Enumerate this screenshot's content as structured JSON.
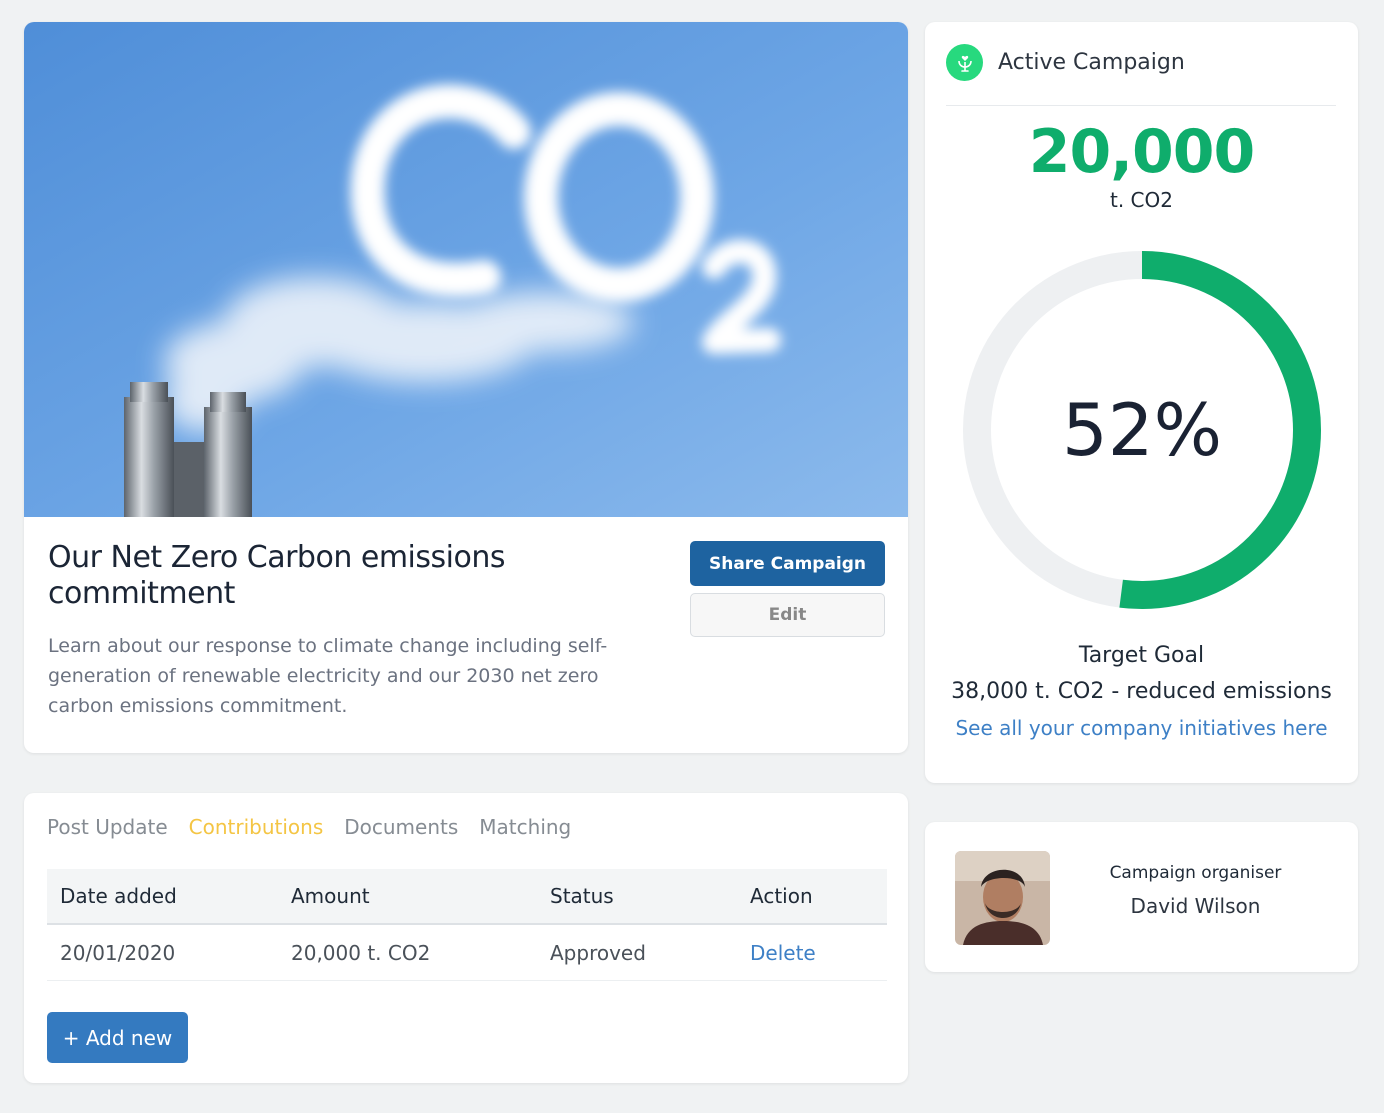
{
  "hero": {
    "title": "Our Net Zero Carbon emissions commitment",
    "description": "Learn about our response to climate change including self-generation of renewable electricity and our 2030 net zero carbon emissions commitment.",
    "share_label": "Share Campaign",
    "edit_label": "Edit",
    "image": "co2-cloud-chimney-photo"
  },
  "tabs": [
    {
      "label": "Post Update",
      "active": false
    },
    {
      "label": "Contributions",
      "active": true
    },
    {
      "label": "Documents",
      "active": false
    },
    {
      "label": "Matching",
      "active": false
    }
  ],
  "table": {
    "headers": [
      "Date added",
      "Amount",
      "Status",
      "Action"
    ],
    "rows": [
      {
        "date": "20/01/2020",
        "amount": "20,000 t. CO2",
        "status": "Approved",
        "action": "Delete"
      }
    ]
  },
  "add_label": "+ Add new",
  "campaign": {
    "label": "Active Campaign",
    "amount": "20,000",
    "unit": "t. CO2",
    "percent_label": "52%",
    "progress": 0.52,
    "goal_label": "Target Goal",
    "goal_value": "38,000 t. CO2 - reduced emissions",
    "link": "See all your company initiatives here",
    "accent": "#0fad6c",
    "icon": "plant-heart-icon"
  },
  "organiser": {
    "role": "Campaign organiser",
    "name": "David Wilson"
  }
}
